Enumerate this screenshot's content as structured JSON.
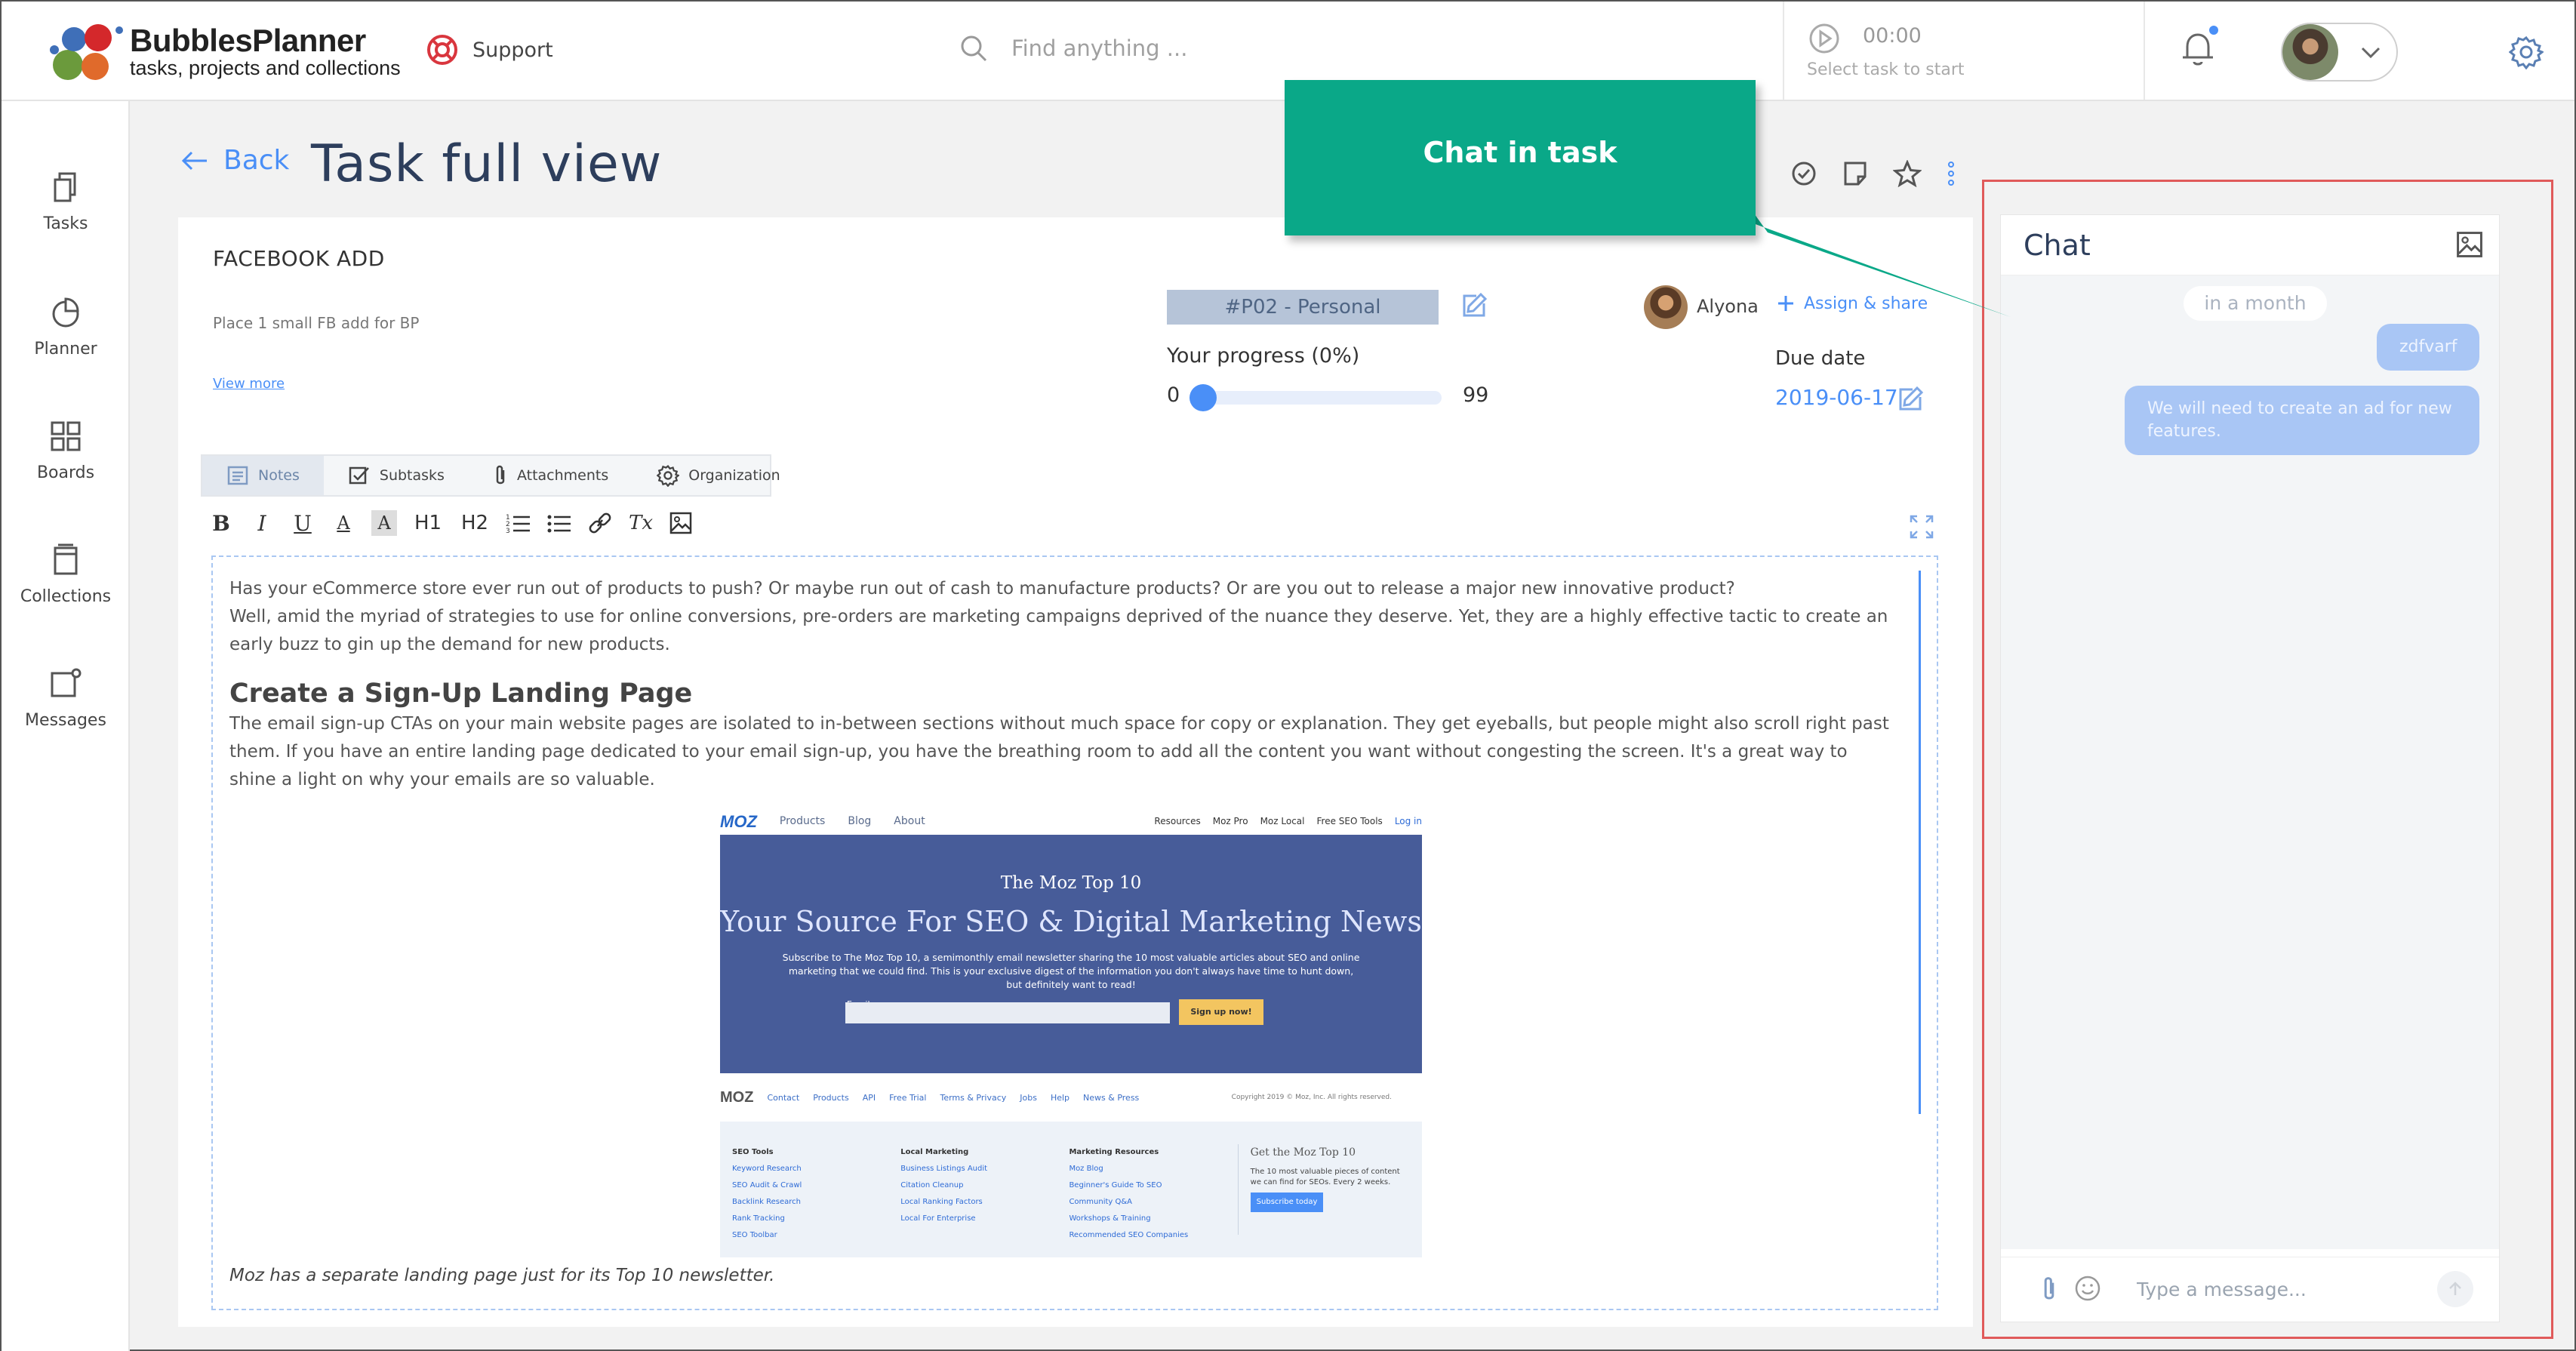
{
  "app": {
    "brand_name": "BubblesPlanner",
    "brand_tagline": "tasks, projects and collections",
    "support_label": "Support"
  },
  "search": {
    "placeholder": "Find anything ..."
  },
  "timer": {
    "time": "00:00",
    "hint": "Select task to start"
  },
  "sidebar": {
    "items": [
      {
        "label": "Tasks",
        "icon": "tasks-icon"
      },
      {
        "label": "Planner",
        "icon": "planner-icon"
      },
      {
        "label": "Boards",
        "icon": "boards-icon"
      },
      {
        "label": "Collections",
        "icon": "collections-icon"
      },
      {
        "label": "Messages",
        "icon": "messages-icon"
      }
    ]
  },
  "page": {
    "back_label": "Back",
    "title": "Task full view"
  },
  "task": {
    "name": "FACEBOOK ADD",
    "description": "Place 1 small FB add for BP",
    "view_more": "View more",
    "project_tag": "#P02 - Personal",
    "assignee": "Alyona",
    "assign_share": "Assign & share",
    "progress_label": "Your progress  (0%)",
    "progress_value": 0,
    "progress_min": "0",
    "progress_max": "99",
    "due_label": "Due date",
    "due_value": "2019-06-17"
  },
  "tabs": [
    {
      "label": "Notes",
      "icon": "notes-icon",
      "active": true
    },
    {
      "label": "Subtasks",
      "icon": "checkbox-icon",
      "active": false
    },
    {
      "label": "Attachments",
      "icon": "paperclip-icon",
      "active": false
    },
    {
      "label": "Organization",
      "icon": "gear-icon",
      "active": false
    }
  ],
  "toolbar": {
    "bold": "B",
    "italic": "I",
    "underline": "U",
    "font_color": "A",
    "highlight": "A",
    "h1": "H1",
    "h2": "H2",
    "clear": "Tx"
  },
  "editor": {
    "p1": "Has your eCommerce store ever run out of products to push? Or maybe run out of cash to manufacture products? Or are you out to release a major new innovative product?",
    "p2": "Well, amid the myriad of strategies to use for online conversions, pre-orders are marketing campaigns deprived of the nuance they deserve. Yet, they are a highly effective tactic to create an early buzz to gin up the demand for new products.",
    "heading": "Create a Sign-Up Landing Page",
    "p3": "The email sign-up CTAs on your main website pages are isolated to in-between sections without much space for copy or explanation. They get eyeballs, but people might also scroll right past them. If you have an entire landing page dedicated to your email sign-up, you have the breathing room to add all the content you want without congesting the screen. It's a great way to shine a light on why your emails are so valuable.",
    "caption": "Moz has a separate landing page just for its Top 10 newsletter.",
    "figure": {
      "logo": "MOZ",
      "nav": [
        "Products",
        "Blog",
        "About"
      ],
      "nav_right": [
        "Resources",
        "Moz Pro",
        "Moz Local",
        "Free SEO Tools",
        "Log in"
      ],
      "kicker": "The Moz Top 10",
      "title": "Your Source For SEO & Digital Marketing News",
      "text": "Subscribe to The Moz Top 10, a semimonthly email newsletter sharing the 10 most valuable articles about SEO and online marketing that we could find. This is your exclusive digest of the information you don't always have time to hunt down, but definitely want to read!",
      "email_label": "Email",
      "button": "Sign up now!",
      "footer_links": [
        "Contact",
        "Products",
        "API",
        "Free Trial",
        "Terms & Privacy",
        "Jobs",
        "Help",
        "News & Press"
      ],
      "copyright": "Copyright 2019 © Moz, Inc. All rights reserved.",
      "columns": [
        {
          "head": "SEO Tools",
          "items": [
            "Keyword Research",
            "SEO Audit & Crawl",
            "Backlink Research",
            "Rank Tracking",
            "SEO Toolbar"
          ]
        },
        {
          "head": "Local Marketing",
          "items": [
            "Business Listings Audit",
            "Citation Cleanup",
            "Local Ranking Factors",
            "Local For Enterprise"
          ]
        },
        {
          "head": "Marketing Resources",
          "items": [
            "Moz Blog",
            "Beginner's Guide To SEO",
            "Community Q&A",
            "Workshops & Training",
            "Recommended SEO Companies"
          ]
        }
      ],
      "sub_title": "Get the Moz Top 10",
      "sub_text": "The 10 most valuable pieces of content we can find for SEOs. Every 2 weeks.",
      "sub_button": "Subscribe today"
    }
  },
  "chat": {
    "title": "Chat",
    "date_divider": "in a month",
    "messages": [
      {
        "text": "zdfvarf"
      },
      {
        "text": "We will need to create an ad for new features."
      }
    ],
    "input_placeholder": "Type a message..."
  },
  "callout": {
    "text": "Chat in task"
  },
  "colors": {
    "accent": "#4a8ff7",
    "callout": "#0aa888",
    "frame": "#e05a5a",
    "title": "#2d3e5c"
  }
}
